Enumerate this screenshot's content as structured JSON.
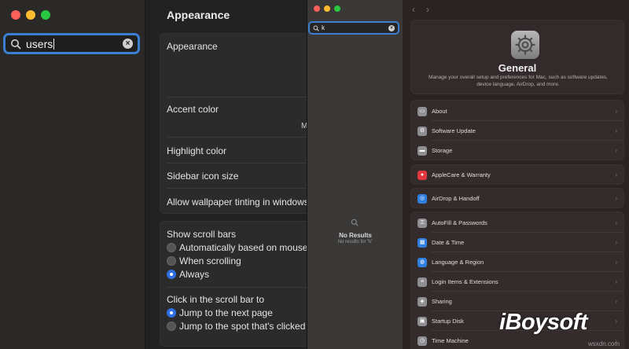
{
  "left_window": {
    "search": {
      "value": "users"
    },
    "pane_title": "Appearance",
    "appearance_group": {
      "rows": [
        "Appearance",
        "Accent color",
        "Highlight color",
        "Sidebar icon size",
        "Allow wallpaper tinting in windows"
      ],
      "clipped_text": "M"
    },
    "scroll_group": {
      "show_scroll_bars_label": "Show scroll bars",
      "show_scroll_bars_options": [
        {
          "label": "Automatically based on mouse",
          "selected": false
        },
        {
          "label": "When scrolling",
          "selected": false
        },
        {
          "label": "Always",
          "selected": true
        }
      ],
      "click_label": "Click in the scroll bar to",
      "click_options": [
        {
          "label": "Jump to the next page",
          "selected": true
        },
        {
          "label": "Jump to the spot that's clicked",
          "selected": false
        }
      ]
    }
  },
  "middle_window": {
    "search": {
      "value": "k"
    },
    "no_results_title": "No Results",
    "no_results_sub": "No results for “k”"
  },
  "right_window": {
    "nav": {
      "back": "‹",
      "forward": "›"
    },
    "header": {
      "icon": "gear-icon",
      "title": "General",
      "description": "Manage your overall setup and preferences for Mac, such as software updates, device language, AirDrop, and more."
    },
    "groups": [
      {
        "items": [
          {
            "label": "About",
            "icon": "mac-icon",
            "color": "#8e8e93"
          },
          {
            "label": "Software Update",
            "icon": "gear-icon",
            "color": "#8e8e93"
          },
          {
            "label": "Storage",
            "icon": "drive-icon",
            "color": "#8e8e93"
          }
        ]
      },
      {
        "items": [
          {
            "label": "AppleCare & Warranty",
            "icon": "apple-icon",
            "color": "#e0383e"
          }
        ]
      },
      {
        "items": [
          {
            "label": "AirDrop & Handoff",
            "icon": "airdrop-icon",
            "color": "#2f7fe0"
          }
        ]
      },
      {
        "items": [
          {
            "label": "AutoFill & Passwords",
            "icon": "key-icon",
            "color": "#8e8e93"
          },
          {
            "label": "Date & Time",
            "icon": "calendar-icon",
            "color": "#2f7fe0"
          },
          {
            "label": "Language & Region",
            "icon": "globe-icon",
            "color": "#2f7fe0"
          },
          {
            "label": "Login Items & Extensions",
            "icon": "list-icon",
            "color": "#8e8e93"
          },
          {
            "label": "Sharing",
            "icon": "sharing-icon",
            "color": "#8e8e93"
          },
          {
            "label": "Startup Disk",
            "icon": "disk-icon",
            "color": "#8e8e93"
          },
          {
            "label": "Time Machine",
            "icon": "clock-icon",
            "color": "#8e8e93"
          }
        ]
      }
    ]
  },
  "watermark": {
    "brand": "iBoysoft",
    "site": "wsxdn.com"
  },
  "colors": {
    "accent": "#2f6fe0",
    "focus_ring": "#3b7fd1"
  }
}
